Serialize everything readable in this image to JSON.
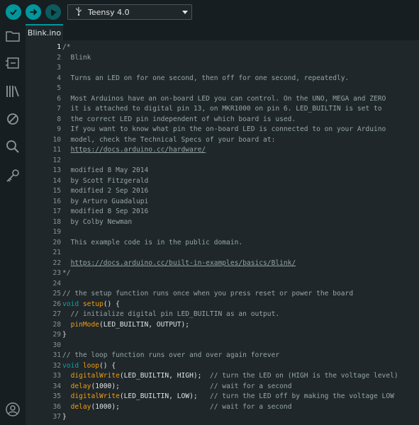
{
  "toolbar": {
    "verify_icon": "checkmark-icon",
    "upload_icon": "arrow-right-icon",
    "debug_icon": "debug-icon",
    "board_icon": "usb-icon",
    "board_name": "Teensy 4.0",
    "dropdown_icon": "chevron-down-icon"
  },
  "sidebar": {
    "items": [
      {
        "icon": "folder-icon"
      },
      {
        "icon": "board-manager-icon"
      },
      {
        "icon": "library-icon"
      },
      {
        "icon": "debug-disabled-icon"
      },
      {
        "icon": "search-icon"
      },
      {
        "icon": "key-icon"
      }
    ],
    "profile_icon": "user-icon"
  },
  "tab": {
    "label": "Blink.ino"
  },
  "colors": {
    "accent": "#00979d",
    "keyword": "#0ca1a6",
    "function": "#f39c12",
    "comment": "#95a5a6",
    "background": "#1f272a"
  },
  "editor": {
    "current_line": 1,
    "lines": [
      {
        "n": "1",
        "segs": [
          {
            "t": "/*",
            "c": "c"
          }
        ]
      },
      {
        "n": "2",
        "segs": [
          {
            "t": "  Blink",
            "c": "c"
          }
        ]
      },
      {
        "n": "3",
        "segs": []
      },
      {
        "n": "4",
        "segs": [
          {
            "t": "  Turns an LED on for one second, then off for one second, repeatedly.",
            "c": "c"
          }
        ]
      },
      {
        "n": "5",
        "segs": []
      },
      {
        "n": "6",
        "segs": [
          {
            "t": "  Most Arduinos have an on-board LED you can control. On the UNO, MEGA and ZERO",
            "c": "c"
          }
        ]
      },
      {
        "n": "7",
        "segs": [
          {
            "t": "  it is attached to digital pin 13, on MKR1000 on pin 6. LED_BUILTIN is set to",
            "c": "c"
          }
        ]
      },
      {
        "n": "8",
        "segs": [
          {
            "t": "  the correct LED pin independent of which board is used.",
            "c": "c"
          }
        ]
      },
      {
        "n": "9",
        "segs": [
          {
            "t": "  If you want to know what pin the on-board LED is connected to on your Arduino",
            "c": "c"
          }
        ]
      },
      {
        "n": "10",
        "segs": [
          {
            "t": "  model, check the Technical Specs of your board at:",
            "c": "c"
          }
        ]
      },
      {
        "n": "11",
        "segs": [
          {
            "t": "  ",
            "c": "c"
          },
          {
            "t": "https://docs.arduino.cc/hardware/",
            "c": "c u"
          }
        ]
      },
      {
        "n": "12",
        "segs": []
      },
      {
        "n": "13",
        "segs": [
          {
            "t": "  modified 8 May 2014",
            "c": "c"
          }
        ]
      },
      {
        "n": "14",
        "segs": [
          {
            "t": "  by Scott Fitzgerald",
            "c": "c"
          }
        ]
      },
      {
        "n": "15",
        "segs": [
          {
            "t": "  modified 2 Sep 2016",
            "c": "c"
          }
        ]
      },
      {
        "n": "16",
        "segs": [
          {
            "t": "  by Arturo Guadalupi",
            "c": "c"
          }
        ]
      },
      {
        "n": "17",
        "segs": [
          {
            "t": "  modified 8 Sep 2016",
            "c": "c"
          }
        ]
      },
      {
        "n": "18",
        "segs": [
          {
            "t": "  by Colby Newman",
            "c": "c"
          }
        ]
      },
      {
        "n": "19",
        "segs": []
      },
      {
        "n": "20",
        "segs": [
          {
            "t": "  This example code is in the public domain.",
            "c": "c"
          }
        ]
      },
      {
        "n": "21",
        "segs": []
      },
      {
        "n": "22",
        "segs": [
          {
            "t": "  ",
            "c": "c"
          },
          {
            "t": "https://docs.arduino.cc/built-in-examples/basics/Blink/",
            "c": "c u"
          }
        ]
      },
      {
        "n": "23",
        "segs": [
          {
            "t": "*/",
            "c": "c"
          }
        ]
      },
      {
        "n": "24",
        "segs": []
      },
      {
        "n": "25",
        "segs": [
          {
            "t": "// the setup function runs once when you press reset or power the board",
            "c": "c"
          }
        ]
      },
      {
        "n": "26",
        "segs": [
          {
            "t": "void",
            "c": "kw"
          },
          {
            "t": " "
          },
          {
            "t": "setup",
            "c": "fn"
          },
          {
            "t": "() {"
          }
        ]
      },
      {
        "n": "27",
        "segs": [
          {
            "t": "  // initialize digital pin LED_BUILTIN as an output.",
            "c": "c"
          }
        ]
      },
      {
        "n": "28",
        "segs": [
          {
            "t": "  "
          },
          {
            "t": "pinMode",
            "c": "fn"
          },
          {
            "t": "(LED_BUILTIN, OUTPUT);"
          }
        ]
      },
      {
        "n": "29",
        "segs": [
          {
            "t": "}"
          }
        ]
      },
      {
        "n": "30",
        "segs": []
      },
      {
        "n": "31",
        "segs": [
          {
            "t": "// the loop function runs over and over again forever",
            "c": "c"
          }
        ]
      },
      {
        "n": "32",
        "segs": [
          {
            "t": "void",
            "c": "kw"
          },
          {
            "t": " "
          },
          {
            "t": "loop",
            "c": "fn"
          },
          {
            "t": "() {"
          }
        ]
      },
      {
        "n": "33",
        "segs": [
          {
            "t": "  "
          },
          {
            "t": "digitalWrite",
            "c": "fn"
          },
          {
            "t": "(LED_BUILTIN, HIGH);  "
          },
          {
            "t": "// turn the LED on (HIGH is the voltage level)",
            "c": "c"
          }
        ]
      },
      {
        "n": "34",
        "segs": [
          {
            "t": "  "
          },
          {
            "t": "delay",
            "c": "fn"
          },
          {
            "t": "(1000);                      "
          },
          {
            "t": "// wait for a second",
            "c": "c"
          }
        ]
      },
      {
        "n": "35",
        "segs": [
          {
            "t": "  "
          },
          {
            "t": "digitalWrite",
            "c": "fn"
          },
          {
            "t": "(LED_BUILTIN, LOW);   "
          },
          {
            "t": "// turn the LED off by making the voltage LOW",
            "c": "c"
          }
        ]
      },
      {
        "n": "36",
        "segs": [
          {
            "t": "  "
          },
          {
            "t": "delay",
            "c": "fn"
          },
          {
            "t": "(1000);                      "
          },
          {
            "t": "// wait for a second",
            "c": "c"
          }
        ]
      },
      {
        "n": "37",
        "segs": [
          {
            "t": "}"
          }
        ]
      }
    ]
  }
}
